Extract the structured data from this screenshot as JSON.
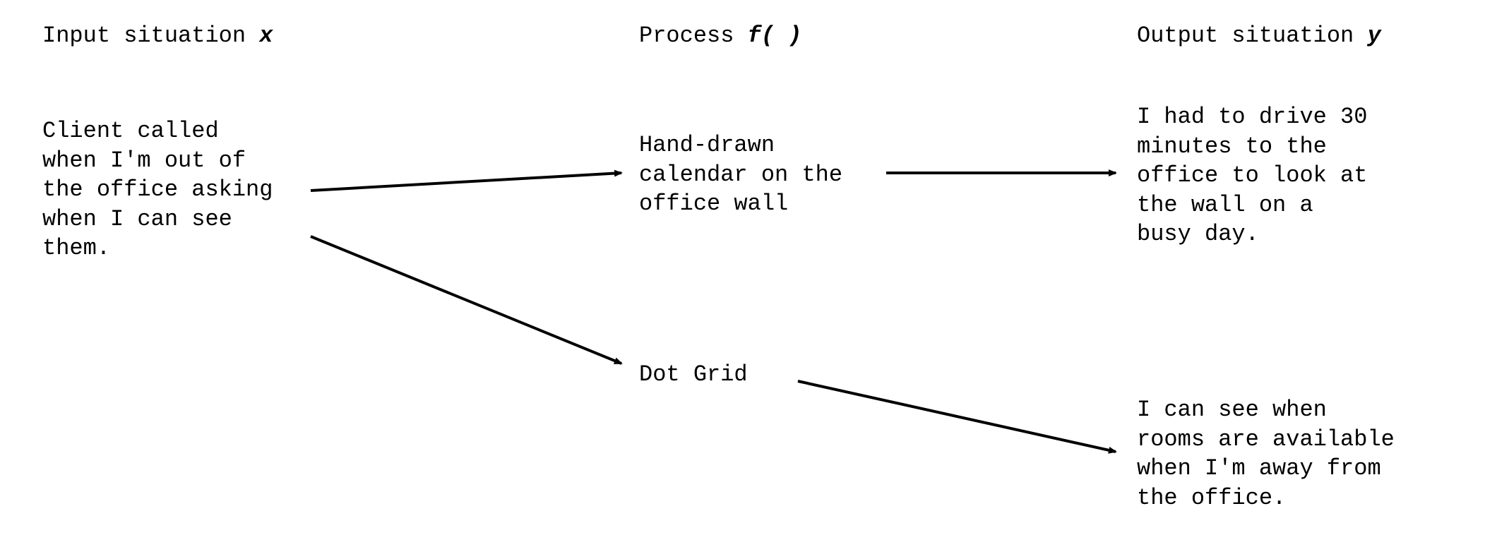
{
  "headings": {
    "input_prefix": "Input situation ",
    "input_var": "x",
    "process_prefix": "Process ",
    "process_var": "f( )",
    "output_prefix": "Output situation ",
    "output_var": "y"
  },
  "input": {
    "text": "Client called\nwhen I'm out of\nthe office asking\nwhen I can see\nthem."
  },
  "process1": {
    "text": "Hand-drawn\ncalendar on the\noffice wall"
  },
  "process2": {
    "text": "Dot Grid"
  },
  "output1": {
    "text": "I had to drive 30\nminutes to the\noffice to look at\nthe wall on a\nbusy day."
  },
  "output2": {
    "text": "I can see when\nrooms are available\nwhen I'm away from\nthe office."
  }
}
